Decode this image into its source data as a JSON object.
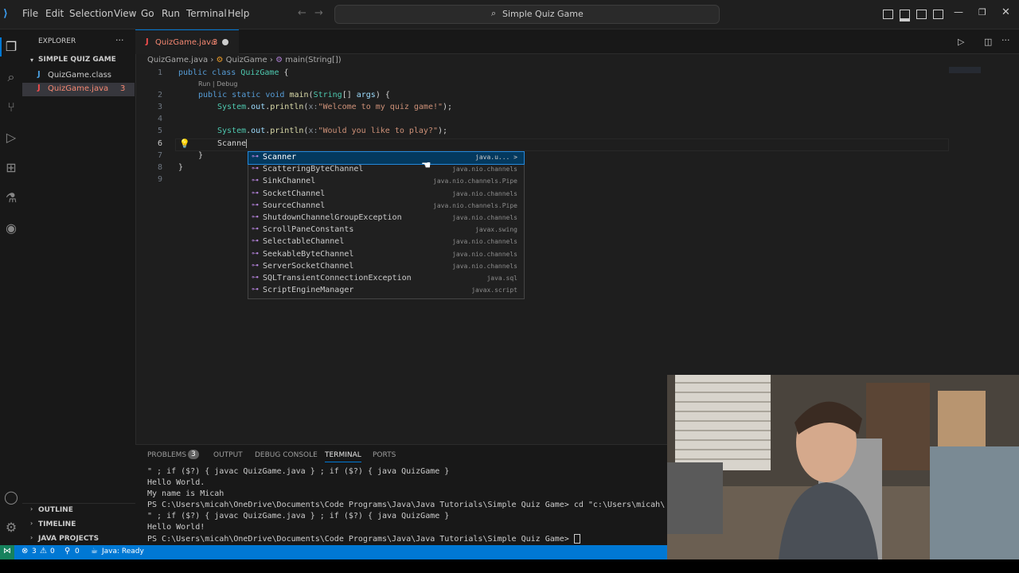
{
  "menu": [
    "File",
    "Edit",
    "Selection",
    "View",
    "Go",
    "Run",
    "Terminal",
    "Help"
  ],
  "search_title": "Simple Quiz Game",
  "explorer": {
    "title": "EXPLORER",
    "folder": "SIMPLE QUIZ GAME",
    "files": [
      {
        "name": "QuizGame.class",
        "badge": ""
      },
      {
        "name": "QuizGame.java",
        "badge": "3"
      }
    ],
    "sections": [
      "OUTLINE",
      "TIMELINE",
      "JAVA PROJECTS"
    ]
  },
  "tab": {
    "label": "QuizGame.java",
    "badge": "3"
  },
  "breadcrumb": [
    "QuizGame.java",
    "QuizGame",
    "main(String[])"
  ],
  "code_lens": "Run | Debug",
  "code": {
    "l1": {
      "kw1": "public",
      "kw2": "class",
      "cls": "QuizGame",
      "rest": "{"
    },
    "l2": {
      "kw1": "public",
      "kw2": "static",
      "kw3": "void",
      "fn": "main",
      "type": "String",
      "rest": "[] ",
      "param": "args",
      "end": ") {"
    },
    "l3": {
      "obj": "System",
      "dot1": ".",
      "out": "out",
      "dot2": ".",
      "fn": "println",
      "hint": "x:",
      "str": "\"Welcome to my quiz game!\"",
      "end": ");"
    },
    "l5": {
      "obj": "System",
      "dot1": ".",
      "out": "out",
      "dot2": ".",
      "fn": "println",
      "hint": "x:",
      "str": "\"Would you like to play?\"",
      "end": ");"
    },
    "l6": "Scanne",
    "l7": "}",
    "l8": "}"
  },
  "line_numbers": [
    "1",
    "2",
    "3",
    "4",
    "5",
    "6",
    "7",
    "8",
    "9"
  ],
  "suggestions": [
    {
      "label": "Scanner",
      "detail": "java.u... >"
    },
    {
      "label": "ScatteringByteChannel",
      "detail": "java.nio.channels"
    },
    {
      "label": "SinkChannel",
      "detail": "java.nio.channels.Pipe"
    },
    {
      "label": "SocketChannel",
      "detail": "java.nio.channels"
    },
    {
      "label": "SourceChannel",
      "detail": "java.nio.channels.Pipe"
    },
    {
      "label": "ShutdownChannelGroupException",
      "detail": "java.nio.channels"
    },
    {
      "label": "ScrollPaneConstants",
      "detail": "javax.swing"
    },
    {
      "label": "SelectableChannel",
      "detail": "java.nio.channels"
    },
    {
      "label": "SeekableByteChannel",
      "detail": "java.nio.channels"
    },
    {
      "label": "ServerSocketChannel",
      "detail": "java.nio.channels"
    },
    {
      "label": "SQLTransientConnectionException",
      "detail": "java.sql"
    },
    {
      "label": "ScriptEngineManager",
      "detail": "javax.script"
    }
  ],
  "panel": {
    "tabs": [
      "PROBLEMS",
      "OUTPUT",
      "DEBUG CONSOLE",
      "TERMINAL",
      "PORTS"
    ],
    "problems_count": "3",
    "terminal_lines": [
      "\" ; if ($?) { javac QuizGame.java } ; if ($?) { java QuizGame }",
      "Hello World.",
      "My name is Micah",
      "PS C:\\Users\\micah\\OneDrive\\Documents\\Code Programs\\Java\\Java Tutorials\\Simple Quiz Game> cd \"c:\\Users\\micah\\",
      "\" ; if ($?) { javac QuizGame.java } ; if ($?) { java QuizGame }",
      "Hello World!",
      "PS C:\\Users\\micah\\OneDrive\\Documents\\Code Programs\\Java\\Java Tutorials\\Simple Quiz Game> "
    ]
  },
  "status": {
    "errors": "3",
    "warnings": "0",
    "ports": "0",
    "java": "Java: Ready"
  }
}
